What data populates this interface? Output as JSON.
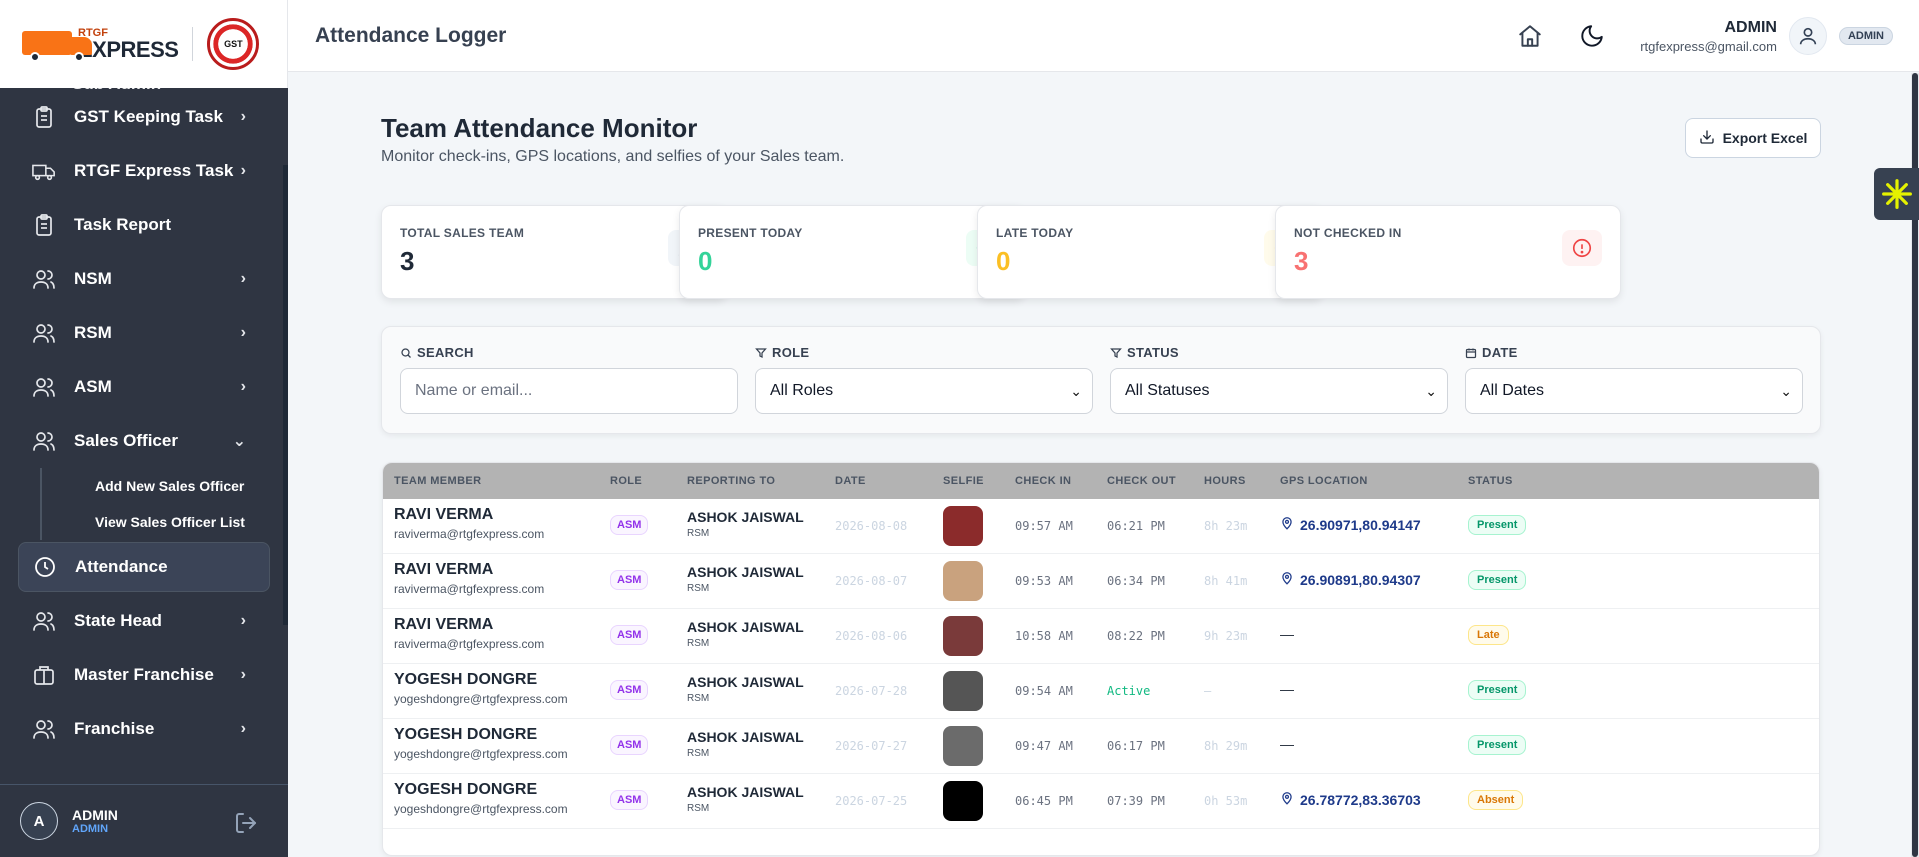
{
  "logo": {
    "small": "RTGF",
    "big": "EXPRESS",
    "seal": "GST"
  },
  "sidebar": {
    "partial_item": "Sub Admin",
    "items": [
      {
        "label": "GST Keeping Task",
        "icon": "clipboard-icon",
        "chevron": "›"
      },
      {
        "label": "RTGF Express Task",
        "icon": "truck-icon",
        "chevron": "›"
      },
      {
        "label": "Task Report",
        "icon": "clipboard-icon",
        "chevron": ""
      },
      {
        "label": "NSM",
        "icon": "users-icon",
        "chevron": "›"
      },
      {
        "label": "RSM",
        "icon": "users-icon",
        "chevron": "›"
      },
      {
        "label": "ASM",
        "icon": "users-icon",
        "chevron": "›"
      },
      {
        "label": "Sales Officer",
        "icon": "users-icon",
        "chevron": "⌄"
      }
    ],
    "sub_items": [
      "Add New Sales Officer",
      "View Sales Officer List"
    ],
    "active_item": "Attendance",
    "items_after": [
      {
        "label": "State Head",
        "icon": "users-icon",
        "chevron": "›"
      },
      {
        "label": "Master Franchise",
        "icon": "briefcase-icon",
        "chevron": "›"
      },
      {
        "label": "Franchise",
        "icon": "users-icon",
        "chevron": "›"
      }
    ],
    "footer": {
      "avatar": "A",
      "name": "ADMIN",
      "role": "ADMIN"
    }
  },
  "header": {
    "title": "Attendance Logger",
    "user_name": "ADMIN",
    "user_email": "rtgfexpress@gmail.com",
    "role_badge": "ADMIN"
  },
  "main": {
    "title": "Team Attendance Monitor",
    "subtitle": "Monitor check-ins, GPS locations, and selfies of your Sales team.",
    "export_label": "Export Excel",
    "stats": [
      {
        "label": "TOTAL SALES TEAM",
        "value": "3",
        "color": "#1f2937",
        "icon_bg": "#f1f5f9",
        "icon_color": "#475569",
        "icon": "users-icon"
      },
      {
        "label": "PRESENT TODAY",
        "value": "0",
        "color": "#34d399",
        "icon_bg": "#ecfdf5",
        "icon_color": "#10b981",
        "icon": "check-circle-icon"
      },
      {
        "label": "LATE TODAY",
        "value": "0",
        "color": "#fbbf24",
        "icon_bg": "#fffbeb",
        "icon_color": "#f59e0b",
        "icon": "clock-icon"
      },
      {
        "label": "NOT CHECKED IN",
        "value": "3",
        "color": "#f87171",
        "icon_bg": "#fef2f2",
        "icon_color": "#ef4444",
        "icon": "alert-circle-icon"
      }
    ],
    "filters": {
      "search_label": "SEARCH",
      "search_placeholder": "Name or email...",
      "role_label": "ROLE",
      "role_value": "All Roles",
      "status_label": "STATUS",
      "status_value": "All Statuses",
      "date_label": "DATE",
      "date_value": "All Dates"
    },
    "table": {
      "columns": [
        "TEAM MEMBER",
        "ROLE",
        "REPORTING TO",
        "DATE",
        "SELFIE",
        "CHECK IN",
        "CHECK OUT",
        "HOURS",
        "GPS LOCATION",
        "STATUS"
      ],
      "rows": [
        {
          "name": "RAVI VERMA",
          "email": "raviverma@rtgfexpress.com",
          "role": "ASM",
          "rep_name": "ASHOK JAISWAL",
          "rep_role": "RSM",
          "date": "2026-08-08",
          "selfie": "#8b2b2b",
          "check_in": "09:57 AM",
          "check_out": "06:21 PM",
          "hours": "8h 23m",
          "gps": "26.90971,80.94147",
          "status": "Present"
        },
        {
          "name": "RAVI VERMA",
          "email": "raviverma@rtgfexpress.com",
          "role": "ASM",
          "rep_name": "ASHOK JAISWAL",
          "rep_role": "RSM",
          "date": "2026-08-07",
          "selfie": "#c9a27e",
          "check_in": "09:53 AM",
          "check_out": "06:34 PM",
          "hours": "8h 41m",
          "gps": "26.90891,80.94307",
          "status": "Present"
        },
        {
          "name": "RAVI VERMA",
          "email": "raviverma@rtgfexpress.com",
          "role": "ASM",
          "rep_name": "ASHOK JAISWAL",
          "rep_role": "RSM",
          "date": "2026-08-06",
          "selfie": "#7a3a3a",
          "check_in": "10:58 AM",
          "check_out": "08:22 PM",
          "hours": "9h 23m",
          "gps": "—",
          "status": "Late"
        },
        {
          "name": "YOGESH DONGRE",
          "email": "yogeshdongre@rtgfexpress.com",
          "role": "ASM",
          "rep_name": "ASHOK JAISWAL",
          "rep_role": "RSM",
          "date": "2026-07-28",
          "selfie": "#555555",
          "check_in": "09:54 AM",
          "check_out": "Active",
          "hours": "—",
          "gps": "—",
          "status": "Present"
        },
        {
          "name": "YOGESH DONGRE",
          "email": "yogeshdongre@rtgfexpress.com",
          "role": "ASM",
          "rep_name": "ASHOK JAISWAL",
          "rep_role": "RSM",
          "date": "2026-07-27",
          "selfie": "#6b6b6b",
          "check_in": "09:47 AM",
          "check_out": "06:17 PM",
          "hours": "8h 29m",
          "gps": "—",
          "status": "Present"
        },
        {
          "name": "YOGESH DONGRE",
          "email": "yogeshdongre@rtgfexpress.com",
          "role": "ASM",
          "rep_name": "ASHOK JAISWAL",
          "rep_role": "RSM",
          "date": "2026-07-25",
          "selfie": "#000000",
          "check_in": "06:45 PM",
          "check_out": "07:39 PM",
          "hours": "0h 53m",
          "gps": "26.78772,83.36703",
          "status": "Absent"
        }
      ]
    }
  }
}
